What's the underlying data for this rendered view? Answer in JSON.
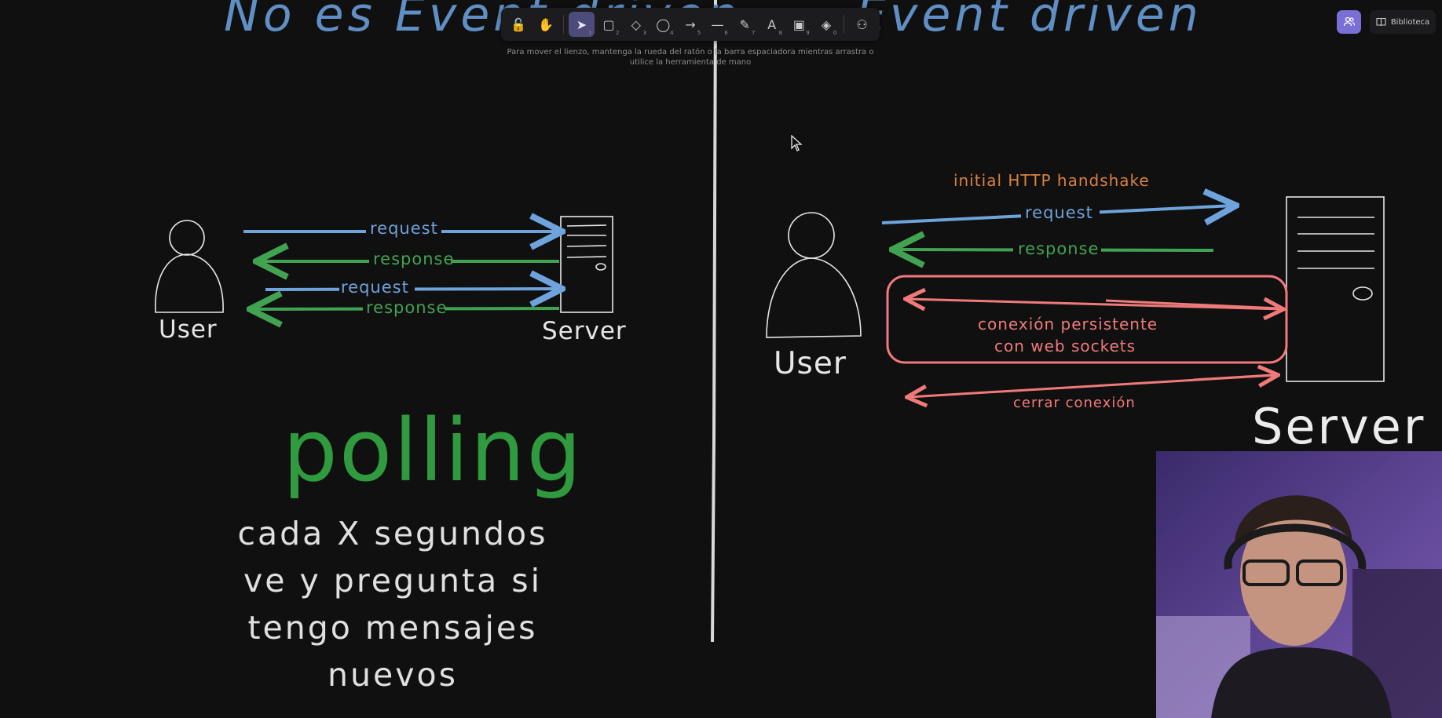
{
  "titles": {
    "left": "No es Event driven",
    "right": "Event driven"
  },
  "toolbar": {
    "tools": [
      {
        "name": "lock",
        "glyph": "🔓",
        "num": ""
      },
      {
        "name": "hand",
        "glyph": "✋",
        "num": ""
      },
      {
        "name": "selection",
        "glyph": "➤",
        "num": "1"
      },
      {
        "name": "rectangle",
        "glyph": "▢",
        "num": "2"
      },
      {
        "name": "diamond",
        "glyph": "◇",
        "num": "3"
      },
      {
        "name": "ellipse",
        "glyph": "◯",
        "num": "4"
      },
      {
        "name": "arrow",
        "glyph": "→",
        "num": "5"
      },
      {
        "name": "line",
        "glyph": "—",
        "num": "6"
      },
      {
        "name": "draw",
        "glyph": "✎",
        "num": "7"
      },
      {
        "name": "text",
        "glyph": "A",
        "num": "8"
      },
      {
        "name": "image",
        "glyph": "▣",
        "num": "9"
      },
      {
        "name": "eraser",
        "glyph": "◈",
        "num": "0"
      },
      {
        "name": "extra-tools",
        "glyph": "⚇",
        "num": ""
      }
    ],
    "hint": "Para mover el lienzo, mantenga la rueda del ratón o la barra espaciadora mientras arrastra o utilice la herramienta de mano"
  },
  "header_buttons": {
    "library": "Biblioteca"
  },
  "diagram_left": {
    "user": "User",
    "server": "Server",
    "request_1": "request",
    "response_1": "response",
    "request_2": "request",
    "response_2": "response",
    "polling": "polling",
    "description": "cada X segundos\nve y pregunta si\ntengo mensajes nuevos"
  },
  "diagram_right": {
    "user": "User",
    "server": "Server",
    "handshake": "initial HTTP handshake",
    "request": "request",
    "response": "response",
    "persistent_line1": "conexión persistente",
    "persistent_line2": "con web sockets",
    "close": "cerrar conexión"
  },
  "colors": {
    "background": "#101010",
    "title_blue": "#5f8fc4",
    "request_blue": "#6ea3dc",
    "response_green": "#41a352",
    "websocket_red": "#f07a7a",
    "handshake_orange": "#d9823e",
    "toolbar_active": "#4d4b7a",
    "collab_purple": "#7a6fd6"
  }
}
